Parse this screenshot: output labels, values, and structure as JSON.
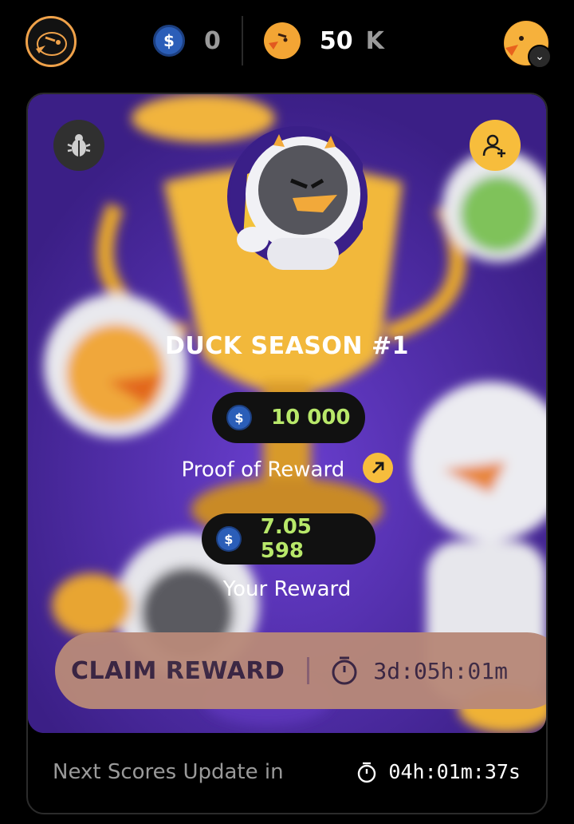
{
  "header": {
    "logo_icon": "angry-duck-logo-icon",
    "usdc_balance": "0",
    "duck_balance": "50",
    "duck_balance_suffix": "K",
    "coin_icon": "usdc-coin-icon",
    "duck_icon": "duck-token-icon"
  },
  "season": {
    "title": "DUCK SEASON #1",
    "pool_amount": "10 000",
    "proof_label": "Proof of Reward",
    "your_reward_amount": "7.05 598",
    "your_reward_label": "Your Reward",
    "claim_label": "CLAIM REWARD",
    "claim_countdown": "3d:05h:01m"
  },
  "footer": {
    "label": "Next Scores Update in",
    "countdown": "04h:01m:37s"
  },
  "colors": {
    "accent_yellow": "#f7bd3c",
    "amount_green": "#b8e86a",
    "banner_purple": "#4d2fa0",
    "claim_bg": "#b88979"
  }
}
